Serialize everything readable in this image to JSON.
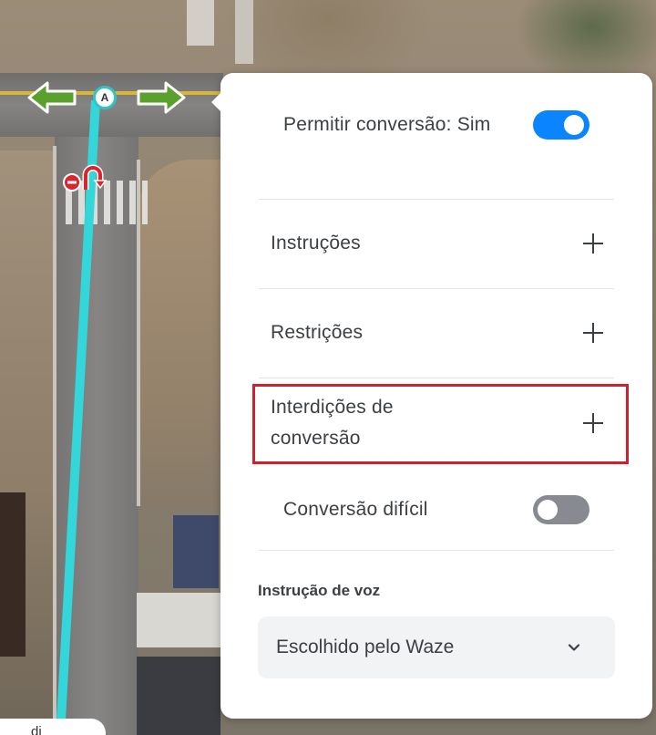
{
  "panel": {
    "allow_turn": {
      "label": "Permitir conversão: Sim",
      "enabled": true
    },
    "instructions": {
      "label": "Instruções"
    },
    "restrictions": {
      "label": "Restrições"
    },
    "turn_closures": {
      "label": "Interdições de conversão"
    },
    "difficult_turn": {
      "label": "Conversão difícil",
      "enabled": false
    },
    "voice_instruction": {
      "title": "Instrução de voz",
      "selected": "Escolhido pelo Waze"
    }
  },
  "map": {
    "node_label": "A",
    "bottom_chip_text": "di"
  },
  "colors": {
    "toggle_on": "#0a84ff",
    "toggle_off": "#878b91",
    "segment": "#33d6d9",
    "arrow_allowed": "#5aa02c",
    "highlight_box": "#d1202a"
  },
  "icons": [
    "plus-icon",
    "chevron-down-icon",
    "arrow-left-icon",
    "arrow-right-icon",
    "u-turn-restricted-icon"
  ]
}
